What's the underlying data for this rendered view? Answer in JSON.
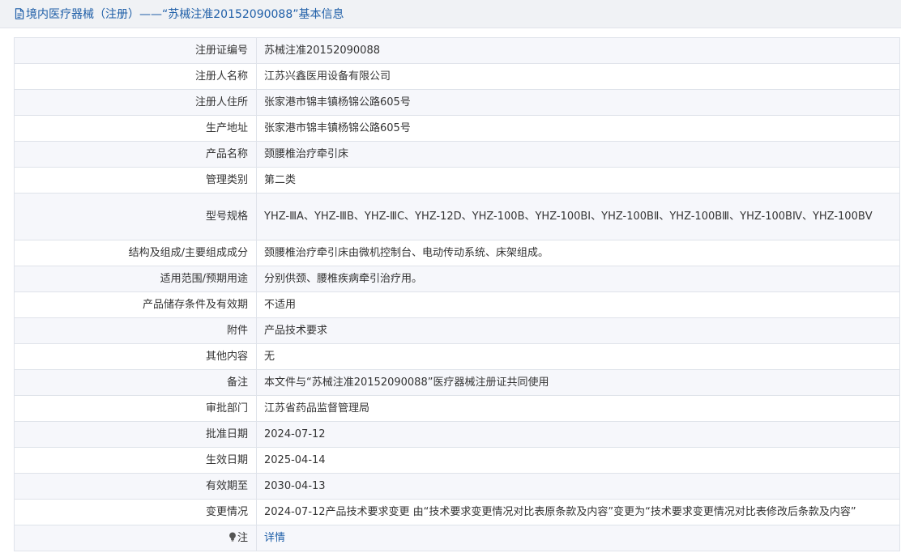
{
  "header": {
    "title": "境内医疗器械（注册）——“苏械注准20152090088”基本信息"
  },
  "rows": [
    {
      "label": "注册证编号",
      "value": "苏械注准20152090088"
    },
    {
      "label": "注册人名称",
      "value": "江苏兴鑫医用设备有限公司"
    },
    {
      "label": "注册人住所",
      "value": "张家港市锦丰镇杨锦公路605号"
    },
    {
      "label": "生产地址",
      "value": "张家港市锦丰镇杨锦公路605号"
    },
    {
      "label": "产品名称",
      "value": "颈腰椎治疗牵引床"
    },
    {
      "label": "管理类别",
      "value": "第二类"
    },
    {
      "label": "型号规格",
      "value": "YHZ-ⅢA、YHZ-ⅢB、YHZ-ⅢC、YHZ-12D、YHZ-100B、YHZ-100BⅠ、YHZ-100BⅡ、YHZ-100BⅢ、YHZ-100BⅣ、YHZ-100BⅤ"
    },
    {
      "label": "结构及组成/主要组成成分",
      "value": "颈腰椎治疗牵引床由微机控制台、电动传动系统、床架组成。"
    },
    {
      "label": "适用范围/预期用途",
      "value": "分别供颈、腰椎疾病牵引治疗用。"
    },
    {
      "label": "产品储存条件及有效期",
      "value": "不适用"
    },
    {
      "label": "附件",
      "value": "产品技术要求"
    },
    {
      "label": "其他内容",
      "value": "无"
    },
    {
      "label": "备注",
      "value": "本文件与“苏械注准20152090088”医疗器械注册证共同使用"
    },
    {
      "label": "审批部门",
      "value": "江苏省药品监督管理局"
    },
    {
      "label": "批准日期",
      "value": "2024-07-12"
    },
    {
      "label": "生效日期",
      "value": "2025-04-14"
    },
    {
      "label": "有效期至",
      "value": "2030-04-13"
    },
    {
      "label": "变更情况",
      "value": "2024-07-12产品技术要求变更 由“技术要求变更情况对比表原条款及内容”变更为“技术要求变更情况对比表修改后条款及内容”"
    }
  ],
  "note_row": {
    "label": "注",
    "link_text": "详情",
    "icon": "bulb-icon"
  },
  "colors": {
    "accent": "#1f5fa8",
    "row_alt": "#f6f7fb",
    "border": "#dfe3ea",
    "header_bg": "#f0f2f5"
  }
}
